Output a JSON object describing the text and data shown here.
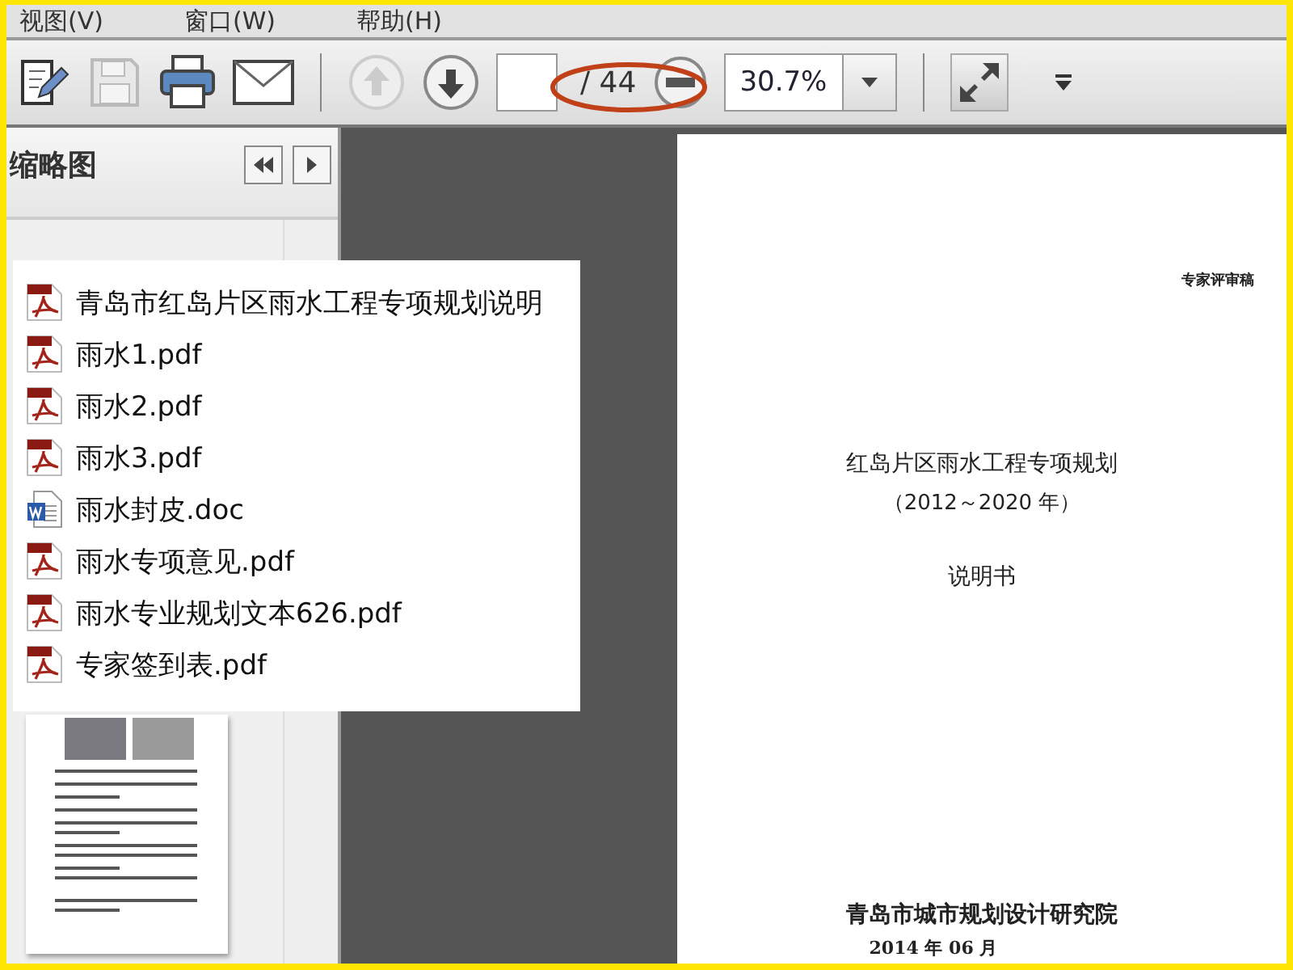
{
  "menu": [
    "视图(V)",
    "窗口(W)",
    "帮助(H)"
  ],
  "toolbar": {
    "page_total": "/ 44",
    "zoom": "30.7%"
  },
  "sidebar": {
    "title": "缩略图"
  },
  "file_list": [
    {
      "name": "青岛市红岛片区雨水工程专项规划说明",
      "kind": "pdf"
    },
    {
      "name": "雨水1.pdf",
      "kind": "pdf"
    },
    {
      "name": "雨水2.pdf",
      "kind": "pdf"
    },
    {
      "name": "雨水3.pdf",
      "kind": "pdf"
    },
    {
      "name": "雨水封皮.doc",
      "kind": "doc"
    },
    {
      "name": "雨水专项意见.pdf",
      "kind": "pdf"
    },
    {
      "name": "雨水专业规划文本626.pdf",
      "kind": "pdf"
    },
    {
      "name": "专家签到表.pdf",
      "kind": "pdf"
    }
  ],
  "document": {
    "stamp": "专家评审稿",
    "title": "红岛片区雨水工程专项规划",
    "years": "（2012～2020 年）",
    "subtitle": "说明书",
    "org": "青岛市城市规划设计研究院",
    "date": "2014 年 06 月"
  }
}
